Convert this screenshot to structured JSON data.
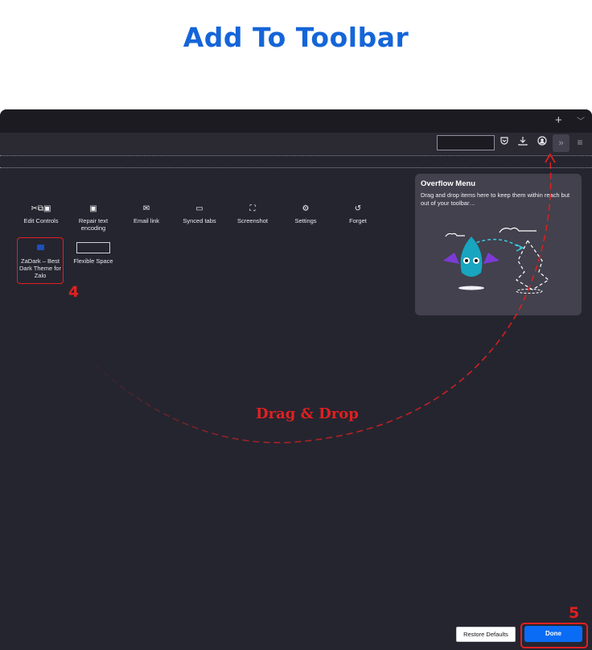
{
  "header": {
    "title": "Add To Toolbar"
  },
  "tabbar": {
    "new_tab_icon": "plus-icon",
    "list_tabs_icon": "chevron-down-icon",
    "plus": "+",
    "chev": "﹀"
  },
  "navbar": {
    "icons": [
      "pocket-icon",
      "download-icon",
      "account-icon",
      "overflow-chevrons-icon",
      "hamburger-menu-icon"
    ],
    "overflow_label": "»",
    "menu_label": "≡"
  },
  "palette": {
    "items": [
      {
        "label": "Edit Controls",
        "icon": "edit-controls-icon",
        "glyph": "✂⧉▣"
      },
      {
        "label": "Repair text encoding",
        "icon": "text-encoding-icon",
        "glyph": "▣"
      },
      {
        "label": "Email link",
        "icon": "email-icon",
        "glyph": "✉"
      },
      {
        "label": "Synced tabs",
        "icon": "synced-tabs-icon",
        "glyph": "▭"
      },
      {
        "label": "Screenshot",
        "icon": "screenshot-icon",
        "glyph": "⛶"
      },
      {
        "label": "Settings",
        "icon": "gear-icon",
        "glyph": "⚙"
      },
      {
        "label": "Forget",
        "icon": "history-icon",
        "glyph": "↺"
      }
    ],
    "zadark": {
      "label": "ZaDark – Best Dark Theme for Zalo",
      "icon": "zadark-icon"
    },
    "flexible_space": {
      "label": "Flexible Space"
    }
  },
  "overflow_menu": {
    "title": "Overflow Menu",
    "text": "Drag and drop items here to keep them within reach but out of your toolbar…"
  },
  "annotations": {
    "step4": "4",
    "step5": "5",
    "drag_drop": "Drag & Drop"
  },
  "footer": {
    "restore_label": "Restore Defaults",
    "done_label": "Done"
  },
  "colors": {
    "accent": "#0a6cf5",
    "annotation": "#e0201f",
    "title": "#1565d8",
    "background": "#252530"
  }
}
